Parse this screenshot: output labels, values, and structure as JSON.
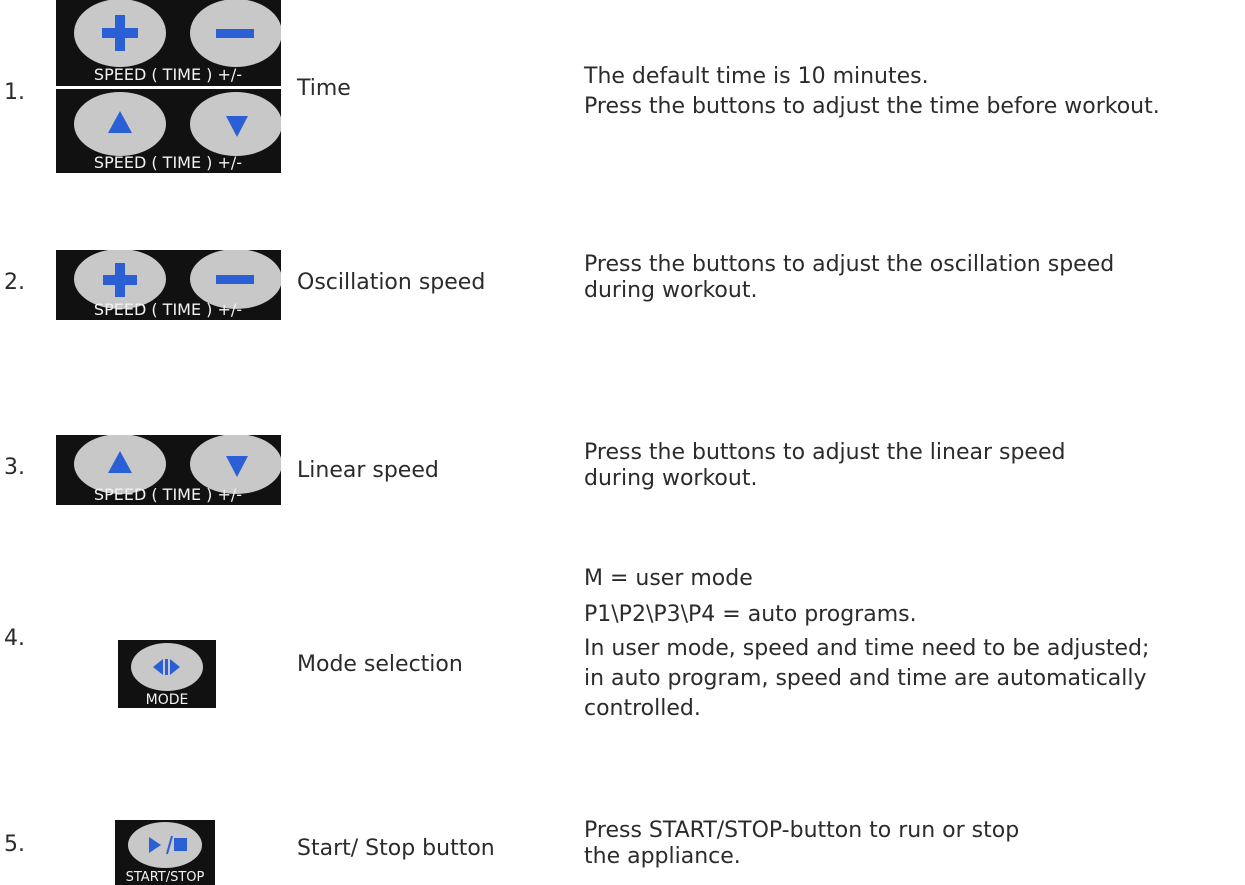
{
  "items": [
    {
      "number": "1.",
      "label": "Time",
      "panel_text": "SPEED ( TIME ) +/-",
      "description": [
        "The default time is 10 minutes.",
        "Press the buttons to adjust the time before workout."
      ]
    },
    {
      "number": "2.",
      "label": "Oscillation speed",
      "panel_text": "SPEED ( TIME ) +/-",
      "description": [
        "Press the buttons to adjust the oscillation speed",
        "during workout."
      ]
    },
    {
      "number": "3.",
      "label": "Linear speed",
      "panel_text": "SPEED ( TIME ) +/-",
      "description": [
        "Press the buttons to adjust the linear speed",
        "during workout."
      ]
    },
    {
      "number": "4.",
      "label": "Mode selection",
      "panel_text": "MODE",
      "description": [
        "M = user mode",
        "P1\\P2\\P3\\P4 = auto programs.",
        "In user mode, speed and time need to be adjusted;",
        "in auto program, speed and time are automatically",
        "controlled."
      ]
    },
    {
      "number": "5.",
      "label": "Start/ Stop button",
      "panel_text": "START/STOP",
      "description": [
        "Press START/STOP-button to run or stop",
        "the appliance."
      ]
    }
  ],
  "colors": {
    "panel_bg": "#111111",
    "button_fill": "#c8c8c8",
    "icon_blue": "#2a5fd6",
    "text": "#2b2b2b"
  }
}
